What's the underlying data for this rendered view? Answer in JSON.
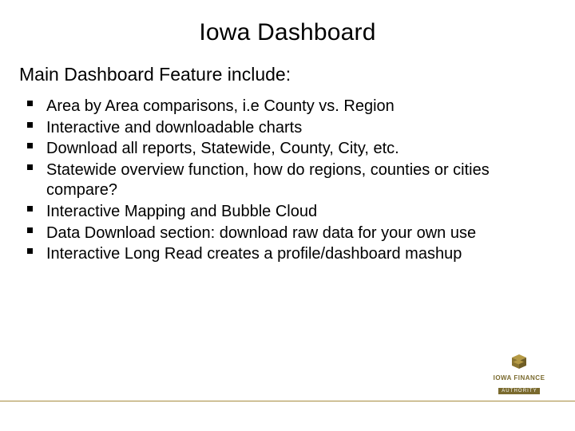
{
  "title": "Iowa Dashboard",
  "subtitle": "Main Dashboard Feature include:",
  "features": [
    "Area by Area comparisons, i.e County vs. Region",
    "Interactive and downloadable charts",
    "Download all reports, Statewide, County, City, etc.",
    "Statewide overview function, how do regions, counties or cities compare?",
    "Interactive Mapping and Bubble Cloud",
    "Data Download section: download raw data for your own use",
    "Interactive Long Read creates a profile/dashboard mashup"
  ],
  "logo": {
    "line1": "IOWA FINANCE",
    "line2": "AUTHORITY"
  }
}
